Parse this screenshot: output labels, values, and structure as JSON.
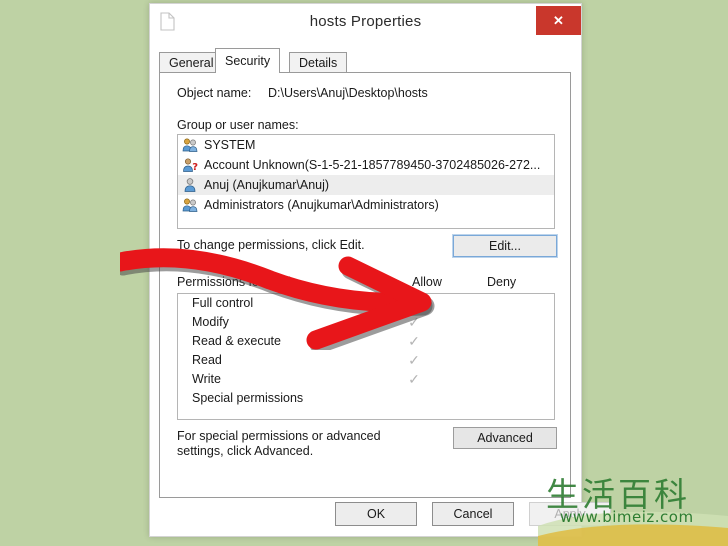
{
  "page": {
    "background_color": "#bed2a4"
  },
  "window": {
    "title": "hosts Properties",
    "icon": "file-document-icon",
    "close_label": "✕",
    "close_color": "#c9372c"
  },
  "tabs": [
    {
      "label": "General",
      "active": false
    },
    {
      "label": "Security",
      "active": true
    },
    {
      "label": "Details",
      "active": false
    }
  ],
  "security": {
    "object_name_label": "Object name:",
    "object_name_value": "D:\\Users\\Anuj\\Desktop\\hosts",
    "group_names_label": "Group or user names:",
    "users": [
      {
        "name": "SYSTEM",
        "icon": "group-users-icon",
        "selected": false
      },
      {
        "name": "Account Unknown(S-1-5-21-1857789450-3702485026-272...",
        "icon": "unknown-user-icon",
        "selected": false
      },
      {
        "name": "Anuj (Anujkumar\\Anuj)",
        "icon": "single-user-icon",
        "selected": true
      },
      {
        "name": "Administrators (Anujkumar\\Administrators)",
        "icon": "group-users-icon",
        "selected": false
      }
    ],
    "change_permissions_text": "To change permissions, click Edit.",
    "edit_button_label": "Edit...",
    "permissions_for_label": "Permissions for Anuj",
    "allow_header": "Allow",
    "deny_header": "Deny",
    "permissions": [
      {
        "name": "Full control",
        "allow": "✓",
        "deny": ""
      },
      {
        "name": "Modify",
        "allow": "✓",
        "deny": ""
      },
      {
        "name": "Read & execute",
        "allow": "✓",
        "deny": ""
      },
      {
        "name": "Read",
        "allow": "✓",
        "deny": ""
      },
      {
        "name": "Write",
        "allow": "✓",
        "deny": ""
      },
      {
        "name": "Special permissions",
        "allow": "",
        "deny": ""
      }
    ],
    "advanced_text": "For special permissions or advanced settings, click Advanced.",
    "advanced_button_label": "Advanced"
  },
  "footer": {
    "ok_label": "OK",
    "cancel_label": "Cancel",
    "apply_label": "Apply"
  },
  "annotation": {
    "arrow_color": "#e8161a",
    "arrow_name": "red-arrow-pointing-to-allow-column"
  },
  "watermark": {
    "characters": "生活百科",
    "url": "www.bimeiz.com",
    "color": "#2e7d32"
  }
}
